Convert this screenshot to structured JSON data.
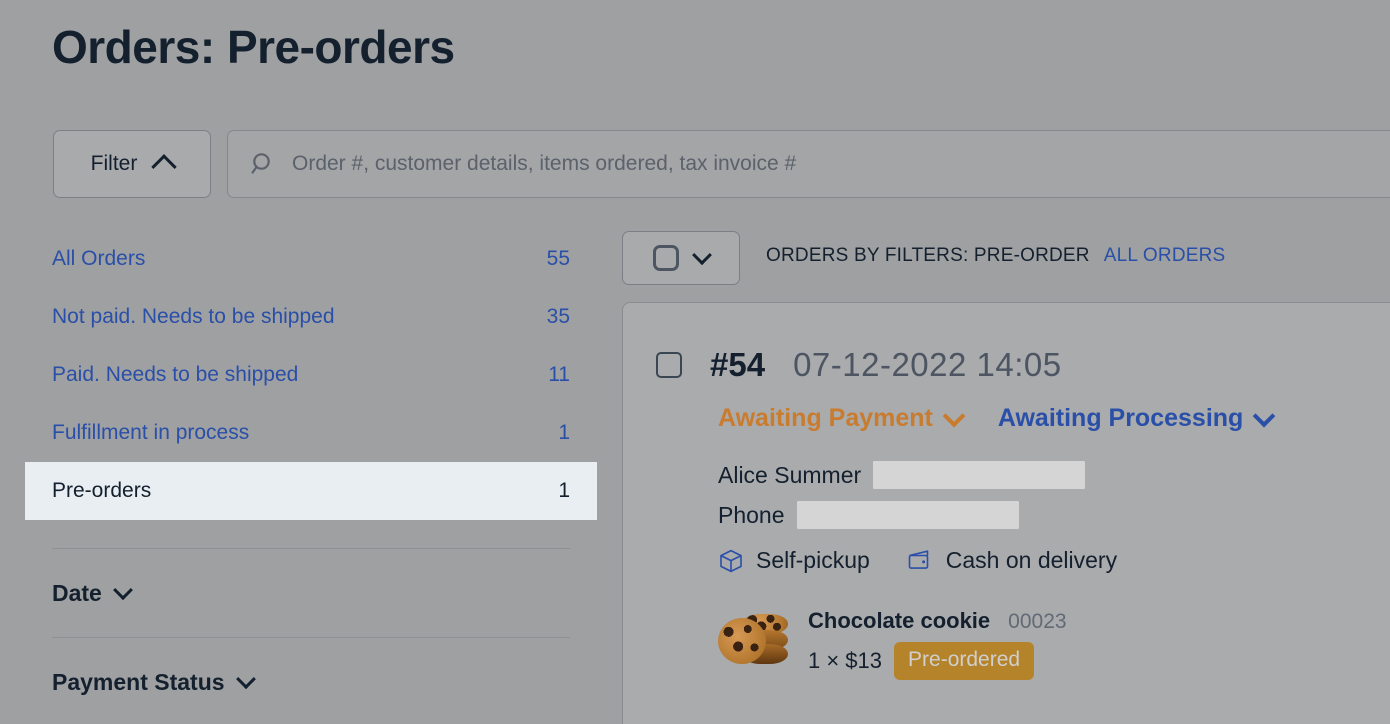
{
  "page": {
    "title": "Orders: Pre-orders"
  },
  "toolbar": {
    "filter_label": "Filter",
    "filter_chevron_icon": "chevron-up-icon",
    "search_icon": "search-icon",
    "search_placeholder": "Order #, customer details, items ordered, tax invoice #",
    "search_value": ""
  },
  "sidebar": {
    "items": [
      {
        "label": "All Orders",
        "count": "55",
        "selected": false
      },
      {
        "label": "Not paid. Needs to be shipped",
        "count": "35",
        "selected": false
      },
      {
        "label": "Paid. Needs to be shipped",
        "count": "11",
        "selected": false
      },
      {
        "label": "Fulfillment in process",
        "count": "1",
        "selected": false
      },
      {
        "label": "Pre-orders",
        "count": "1",
        "selected": true
      }
    ],
    "sections": [
      {
        "label": "Date",
        "chevron_icon": "chevron-down-icon"
      },
      {
        "label": "Payment Status",
        "chevron_icon": "chevron-down-icon"
      }
    ]
  },
  "list_toolbar": {
    "select_all_checkbox": "checkbox-icon",
    "select_all_chevron_icon": "chevron-down-icon",
    "filters_title": "ORDERS BY FILTERS: PRE-ORDER",
    "all_orders_link": "ALL ORDERS"
  },
  "order": {
    "checkbox": "checkbox-icon",
    "number": "#54",
    "datetime": "07-12-2022 14:05",
    "payment_status": "Awaiting Payment",
    "payment_status_chevron": "chevron-down-icon",
    "fulfillment_status": "Awaiting Processing",
    "fulfillment_status_chevron": "chevron-down-icon",
    "customer_name": "Alice Summer",
    "customer_email_redacted": "",
    "phone_label": "Phone",
    "phone_redacted": "",
    "shipping_method": "Self-pickup",
    "shipping_icon": "package-box-icon",
    "payment_method": "Cash on delivery",
    "payment_icon": "wallet-icon",
    "product": {
      "image": "chocolate-cookie-stack-photo",
      "name": "Chocolate cookie",
      "sku": "00023",
      "quantity_price": "1 × $13",
      "badge": "Pre-ordered"
    }
  },
  "colors": {
    "page_background": "#9fa0a2",
    "card_background": "#aaabad",
    "link_blue": "#2a4fa8",
    "status_orange": "#c97b2e",
    "badge_gold": "#b5832a",
    "selected_row": "#e9eef2",
    "text_dark": "#14202e",
    "redaction_gray": "#d5d5d5"
  }
}
